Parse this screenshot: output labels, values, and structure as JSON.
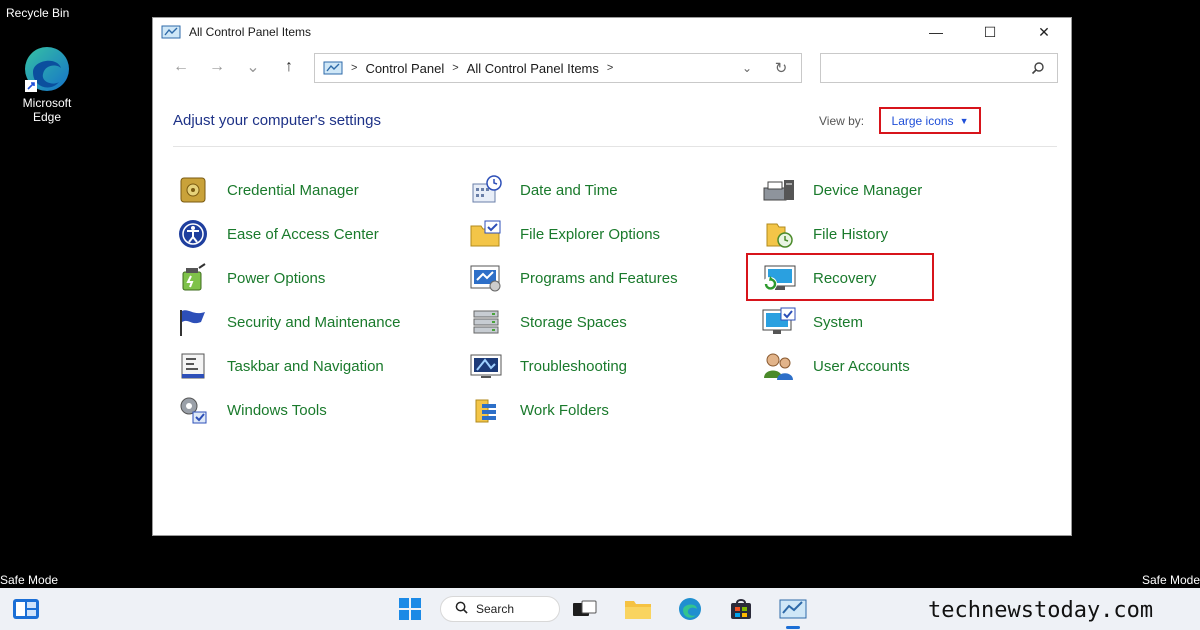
{
  "desktop": {
    "recycle_bin_label": "Recycle Bin",
    "edge_label": "Microsoft Edge",
    "safe_mode_left": "Safe Mode",
    "safe_mode_right": "Safe Mode"
  },
  "window": {
    "title": "All Control Panel Items",
    "controls": {
      "minimize": "—",
      "maximize": "☐",
      "close": "✕"
    },
    "nav": {
      "back": "←",
      "forward": "→",
      "recent": "⌄",
      "up": "↑"
    },
    "address": {
      "crumbs": [
        "Control Panel",
        "All Control Panel Items"
      ],
      "separator": ">",
      "dropdown": "⌄",
      "refresh": "↻"
    },
    "search": {
      "placeholder": ""
    }
  },
  "content": {
    "heading": "Adjust your computer's settings",
    "view_by_label": "View by:",
    "view_by_value": "Large icons",
    "view_by_caret": "▼"
  },
  "items": [
    {
      "label": "Credential Manager",
      "icon": "safe-icon"
    },
    {
      "label": "Date and Time",
      "icon": "calendar-clock-icon"
    },
    {
      "label": "Device Manager",
      "icon": "printer-device-icon"
    },
    {
      "label": "Ease of Access Center",
      "icon": "accessibility-icon"
    },
    {
      "label": "File Explorer Options",
      "icon": "folder-check-icon"
    },
    {
      "label": "File History",
      "icon": "file-history-icon"
    },
    {
      "label": "Power Options",
      "icon": "battery-icon"
    },
    {
      "label": "Programs and Features",
      "icon": "programs-icon"
    },
    {
      "label": "Recovery",
      "icon": "recovery-monitor-icon"
    },
    {
      "label": "Security and Maintenance",
      "icon": "flag-icon"
    },
    {
      "label": "Storage Spaces",
      "icon": "storage-stack-icon"
    },
    {
      "label": "System",
      "icon": "monitor-check-icon"
    },
    {
      "label": "Taskbar and Navigation",
      "icon": "taskbar-icon"
    },
    {
      "label": "Troubleshooting",
      "icon": "troubleshoot-icon"
    },
    {
      "label": "User Accounts",
      "icon": "users-icon"
    },
    {
      "label": "Windows Tools",
      "icon": "gears-icon"
    },
    {
      "label": "Work Folders",
      "icon": "work-folders-icon"
    }
  ],
  "taskbar": {
    "search_label": "Search",
    "watermark": "technewstoday.com"
  },
  "colors": {
    "item_text": "#1a7a2c",
    "heading": "#1e3287",
    "highlight": "#d7141b",
    "link_blue": "#1f4fd8"
  }
}
